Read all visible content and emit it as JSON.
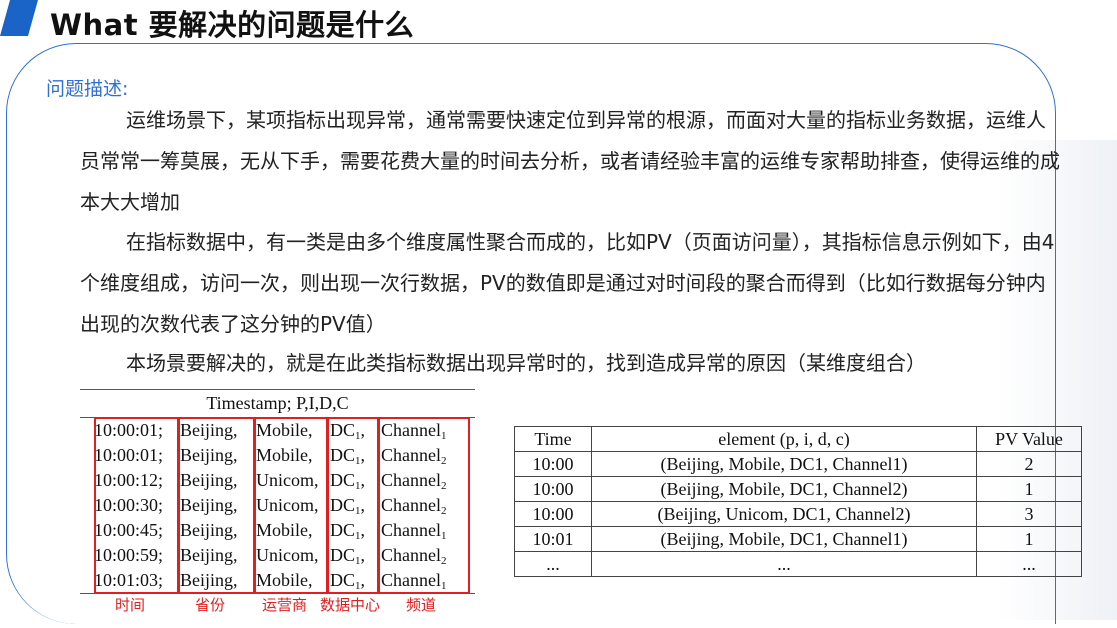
{
  "title": "What 要解决的问题是什么",
  "section_label": "问题描述:",
  "paragraphs": [
    "运维场景下，某项指标出现异常，通常需要快速定位到异常的根源，而面对大量的指标业务数据，运维人员常常一筹莫展，无从下手，需要花费大量的时间去分析，或者请经验丰富的运维专家帮助排查，使得运维的成本大大增加",
    "在指标数据中，有一类是由多个维度属性聚合而成的，比如PV（页面访问量），其指标信息示例如下，由4个维度组成，访问一次，则出现一次行数据，PV的数值即是通过对时间段的聚合而得到（比如行数据每分钟内出现的次数代表了这分钟的PV值）",
    "本场景要解决的，就是在此类指标数据出现异常时的，找到造成异常的原因（某维度组合）"
  ],
  "log_table": {
    "header": "Timestamp; P,I,D,C",
    "rows": [
      {
        "time": "10:00:01;",
        "prov": "Beijing,",
        "op": "Mobile,",
        "dc": "DC",
        "dc_sub": "1",
        "ch": "Channel",
        "ch_sub": "1"
      },
      {
        "time": "10:00:01;",
        "prov": "Beijing,",
        "op": "Mobile,",
        "dc": "DC",
        "dc_sub": "1",
        "ch": "Channel",
        "ch_sub": "2"
      },
      {
        "time": "10:00:12;",
        "prov": "Beijing,",
        "op": "Unicom,",
        "dc": "DC",
        "dc_sub": "1",
        "ch": "Channel",
        "ch_sub": "2"
      },
      {
        "time": "10:00:30;",
        "prov": "Beijing,",
        "op": "Unicom,",
        "dc": "DC",
        "dc_sub": "1",
        "ch": "Channel",
        "ch_sub": "2"
      },
      {
        "time": "10:00:45;",
        "prov": "Beijing,",
        "op": "Mobile,",
        "dc": "DC",
        "dc_sub": "1",
        "ch": "Channel",
        "ch_sub": "1"
      },
      {
        "time": "10:00:59;",
        "prov": "Beijing,",
        "op": "Unicom,",
        "dc": "DC",
        "dc_sub": "1",
        "ch": "Channel",
        "ch_sub": "2"
      },
      {
        "time": "10:01:03;",
        "prov": "Beijing,",
        "op": "Mobile,",
        "dc": "DC",
        "dc_sub": "1",
        "ch": "Channel",
        "ch_sub": "1"
      }
    ],
    "column_labels": [
      "时间",
      "省份",
      "运营商",
      "数据中心",
      "频道"
    ]
  },
  "pv_table": {
    "headers": [
      "Time",
      "element (p, i, d, c)",
      "PV Value"
    ],
    "rows": [
      {
        "time": "10:00",
        "element": "(Beijing, Mobile, DC1, Channel1)",
        "pv": "2"
      },
      {
        "time": "10:00",
        "element": "(Beijing, Mobile, DC1, Channel2)",
        "pv": "1"
      },
      {
        "time": "10:00",
        "element": "(Beijing, Unicom, DC1, Channel2)",
        "pv": "3"
      },
      {
        "time": "10:01",
        "element": "(Beijing, Mobile, DC1, Channel1)",
        "pv": "1"
      },
      {
        "time": "...",
        "element": "...",
        "pv": "..."
      }
    ]
  },
  "colors": {
    "accent": "#1a63c7",
    "frame": "#2f6fd6",
    "highlight": "#e02020"
  }
}
